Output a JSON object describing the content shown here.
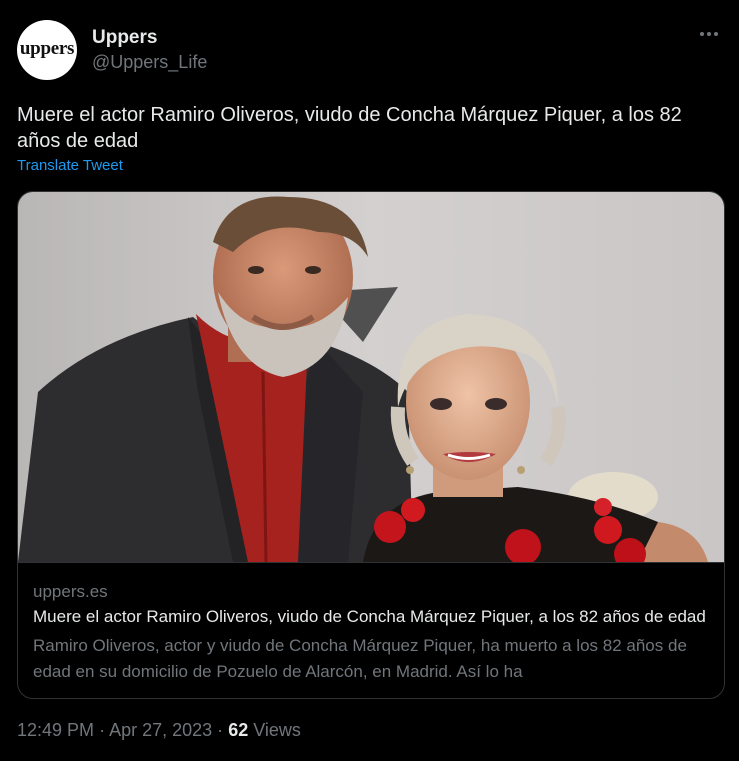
{
  "author": {
    "avatar_text": "uppers",
    "name": "Uppers",
    "handle": "@Uppers_Life"
  },
  "tweet": {
    "text": "Muere el actor Ramiro Oliveros, viudo de Concha Márquez Piquer, a los 82 años de edad",
    "translate_label": "Translate Tweet"
  },
  "card": {
    "domain": "uppers.es",
    "title": "Muere el actor Ramiro Oliveros, viudo de Concha Márquez Piquer, a los 82 años de edad",
    "description": "Ramiro Oliveros, actor y viudo de Concha Márquez Piquer, ha muerto a los 82 años de edad en su domicilio de Pozuelo de Alarcón, en Madrid. Así lo ha"
  },
  "meta": {
    "time": "12:49 PM",
    "separator": "·",
    "date": "Apr 27, 2023",
    "views_count": "62",
    "views_label": "Views"
  },
  "colors": {
    "background": "#000000",
    "text": "#e7e9ea",
    "secondary": "#71767b",
    "link": "#1d9bf0",
    "border": "#2f3336"
  },
  "icons": {
    "more": "more-options-icon"
  }
}
